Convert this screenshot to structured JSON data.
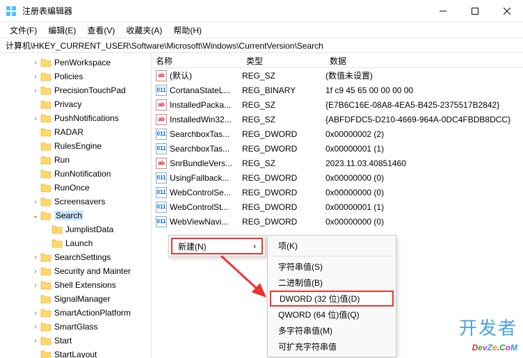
{
  "window": {
    "title": "注册表编辑器"
  },
  "menubar": {
    "file": "文件(F)",
    "edit": "编辑(E)",
    "view": "查看(V)",
    "fav": "收藏夹(A)",
    "help": "帮助(H)"
  },
  "address": "计算机\\HKEY_CURRENT_USER\\Software\\Microsoft\\Windows\\CurrentVersion\\Search",
  "tree": [
    {
      "indent": 44,
      "chev": ">",
      "label": "PenWorkspace"
    },
    {
      "indent": 44,
      "chev": ">",
      "label": "Policies"
    },
    {
      "indent": 44,
      "chev": ">",
      "label": "PrecisionTouchPad"
    },
    {
      "indent": 44,
      "chev": "",
      "label": "Privacy"
    },
    {
      "indent": 44,
      "chev": ">",
      "label": "PushNotifications"
    },
    {
      "indent": 44,
      "chev": "",
      "label": "RADAR"
    },
    {
      "indent": 44,
      "chev": "",
      "label": "RulesEngine"
    },
    {
      "indent": 44,
      "chev": "",
      "label": "Run"
    },
    {
      "indent": 44,
      "chev": "",
      "label": "RunNotification"
    },
    {
      "indent": 44,
      "chev": "",
      "label": "RunOnce"
    },
    {
      "indent": 44,
      "chev": ">",
      "label": "Screensavers"
    },
    {
      "indent": 44,
      "chev": "v",
      "label": "Search",
      "selected": true
    },
    {
      "indent": 60,
      "chev": "",
      "label": "JumplistData"
    },
    {
      "indent": 60,
      "chev": "",
      "label": "Launch"
    },
    {
      "indent": 44,
      "chev": ">",
      "label": "SearchSettings"
    },
    {
      "indent": 44,
      "chev": ">",
      "label": "Security and Mainter"
    },
    {
      "indent": 44,
      "chev": ">",
      "label": "Shell Extensions"
    },
    {
      "indent": 44,
      "chev": "",
      "label": "SignalManager"
    },
    {
      "indent": 44,
      "chev": ">",
      "label": "SmartActionPlatform"
    },
    {
      "indent": 44,
      "chev": ">",
      "label": "SmartGlass"
    },
    {
      "indent": 44,
      "chev": ">",
      "label": "Start"
    },
    {
      "indent": 44,
      "chev": "",
      "label": "StartLayout"
    }
  ],
  "columns": {
    "name": "名称",
    "type": "类型",
    "data": "数据"
  },
  "values": [
    {
      "icon": "sz",
      "name": "(默认)",
      "type": "REG_SZ",
      "data": "(数值未设置)"
    },
    {
      "icon": "bin",
      "name": "CortanaStateL...",
      "type": "REG_BINARY",
      "data": "1f c9 45 65 00 00 00 00"
    },
    {
      "icon": "sz",
      "name": "InstalledPacka...",
      "type": "REG_SZ",
      "data": "{E7B6C16E-08A8-4EA5-B425-2375517B2842}"
    },
    {
      "icon": "sz",
      "name": "InstalledWin32...",
      "type": "REG_SZ",
      "data": "{ABFDFDC5-D210-4669-964A-0DC4FBDB8DCC}"
    },
    {
      "icon": "bin",
      "name": "SearchboxTas...",
      "type": "REG_DWORD",
      "data": "0x00000002 (2)"
    },
    {
      "icon": "bin",
      "name": "SearchboxTas...",
      "type": "REG_DWORD",
      "data": "0x00000001 (1)"
    },
    {
      "icon": "sz",
      "name": "SnrBundleVers...",
      "type": "REG_SZ",
      "data": "2023.11.03.40851460"
    },
    {
      "icon": "bin",
      "name": "UsingFallback...",
      "type": "REG_DWORD",
      "data": "0x00000000 (0)"
    },
    {
      "icon": "bin",
      "name": "WebControlSe...",
      "type": "REG_DWORD",
      "data": "0x00000000 (0)"
    },
    {
      "icon": "bin",
      "name": "WebControlSt...",
      "type": "REG_DWORD",
      "data": "0x00000001 (1)"
    },
    {
      "icon": "bin",
      "name": "WebViewNavi...",
      "type": "REG_DWORD",
      "data": "0x00000000 (0)"
    }
  ],
  "ctx1": {
    "new": "新建(N)",
    "arrow": "›"
  },
  "ctx2": {
    "key": "项(K)",
    "string": "字符串值(S)",
    "binary": "二进制值(B)",
    "dword": "DWORD (32 位)值(D)",
    "qword": "QWORD (64 位)值(Q)",
    "multi": "多字符串值(M)",
    "expand": "可扩充字符串值"
  },
  "watermark": {
    "line1": "开发者",
    "line2": "DevZe.CoM"
  }
}
